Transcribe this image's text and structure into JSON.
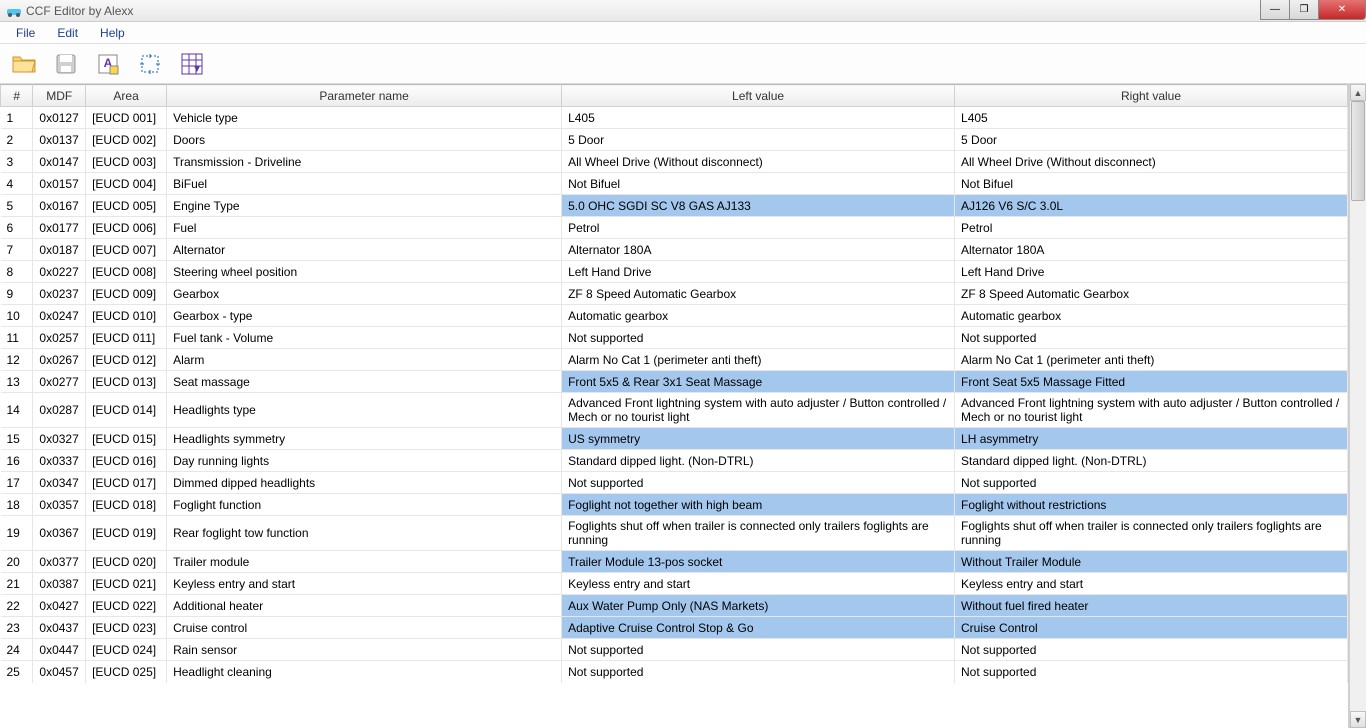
{
  "window": {
    "title": "CCF Editor by Alexx"
  },
  "menu": {
    "file": "File",
    "edit": "Edit",
    "help": "Help"
  },
  "columns": {
    "idx": "#",
    "mdf": "MDF",
    "area": "Area",
    "param": "Parameter name",
    "left": "Left value",
    "right": "Right value"
  },
  "rows": [
    {
      "i": "1",
      "mdf": "0x0127",
      "area": "[EUCD 001]",
      "param": "Vehicle type",
      "left": "L405",
      "right": "L405",
      "hl": false
    },
    {
      "i": "2",
      "mdf": "0x0137",
      "area": "[EUCD 002]",
      "param": "Doors",
      "left": "5 Door",
      "right": "5 Door",
      "hl": false
    },
    {
      "i": "3",
      "mdf": "0x0147",
      "area": "[EUCD 003]",
      "param": "Transmission - Driveline",
      "left": "All Wheel Drive (Without disconnect)",
      "right": "All Wheel Drive (Without disconnect)",
      "hl": false
    },
    {
      "i": "4",
      "mdf": "0x0157",
      "area": "[EUCD 004]",
      "param": "BiFuel",
      "left": "Not Bifuel",
      "right": "Not Bifuel",
      "hl": false
    },
    {
      "i": "5",
      "mdf": "0x0167",
      "area": "[EUCD 005]",
      "param": "Engine Type",
      "left": "5.0 OHC SGDI SC V8 GAS AJ133",
      "right": "AJ126 V6 S/C 3.0L",
      "hl": true
    },
    {
      "i": "6",
      "mdf": "0x0177",
      "area": "[EUCD 006]",
      "param": "Fuel",
      "left": "Petrol",
      "right": "Petrol",
      "hl": false
    },
    {
      "i": "7",
      "mdf": "0x0187",
      "area": "[EUCD 007]",
      "param": "Alternator",
      "left": "Alternator 180A",
      "right": "Alternator 180A",
      "hl": false
    },
    {
      "i": "8",
      "mdf": "0x0227",
      "area": "[EUCD 008]",
      "param": "Steering wheel position",
      "left": "Left Hand Drive",
      "right": "Left Hand Drive",
      "hl": false
    },
    {
      "i": "9",
      "mdf": "0x0237",
      "area": "[EUCD 009]",
      "param": "Gearbox",
      "left": "ZF 8 Speed Automatic Gearbox",
      "right": "ZF 8 Speed Automatic Gearbox",
      "hl": false
    },
    {
      "i": "10",
      "mdf": "0x0247",
      "area": "[EUCD 010]",
      "param": "Gearbox - type",
      "left": "Automatic gearbox",
      "right": "Automatic gearbox",
      "hl": false
    },
    {
      "i": "11",
      "mdf": "0x0257",
      "area": "[EUCD 011]",
      "param": "Fuel tank - Volume",
      "left": "Not supported",
      "right": "Not supported",
      "hl": false
    },
    {
      "i": "12",
      "mdf": "0x0267",
      "area": "[EUCD 012]",
      "param": "Alarm",
      "left": "Alarm No Cat 1 (perimeter anti theft)",
      "right": "Alarm No Cat 1 (perimeter anti theft)",
      "hl": false
    },
    {
      "i": "13",
      "mdf": "0x0277",
      "area": "[EUCD 013]",
      "param": "Seat massage",
      "left": "Front 5x5 & Rear 3x1 Seat Massage",
      "right": "Front Seat 5x5 Massage Fitted",
      "hl": true
    },
    {
      "i": "14",
      "mdf": "0x0287",
      "area": "[EUCD 014]",
      "param": "Headlights type",
      "left": "Advanced Front lightning system with auto adjuster / Button controlled / Mech or no tourist light",
      "right": "Advanced Front lightning system with auto adjuster / Button controlled / Mech or no tourist light",
      "hl": false,
      "tall": true
    },
    {
      "i": "15",
      "mdf": "0x0327",
      "area": "[EUCD 015]",
      "param": "Headlights symmetry",
      "left": "US symmetry",
      "right": "LH asymmetry",
      "hl": true
    },
    {
      "i": "16",
      "mdf": "0x0337",
      "area": "[EUCD 016]",
      "param": "Day running lights",
      "left": "Standard dipped light. (Non-DTRL)",
      "right": "Standard dipped light. (Non-DTRL)",
      "hl": false
    },
    {
      "i": "17",
      "mdf": "0x0347",
      "area": "[EUCD 017]",
      "param": "Dimmed dipped headlights",
      "left": "Not supported",
      "right": "Not supported",
      "hl": false
    },
    {
      "i": "18",
      "mdf": "0x0357",
      "area": "[EUCD 018]",
      "param": "Foglight function",
      "left": "Foglight not together with high beam",
      "right": "Foglight without restrictions",
      "hl": true
    },
    {
      "i": "19",
      "mdf": "0x0367",
      "area": "[EUCD 019]",
      "param": "Rear foglight tow function",
      "left": "Foglights shut off when trailer is connected only trailers foglights are running",
      "right": "Foglights shut off when trailer is connected only trailers foglights are running",
      "hl": false,
      "tall": true
    },
    {
      "i": "20",
      "mdf": "0x0377",
      "area": "[EUCD 020]",
      "param": "Trailer module",
      "left": "Trailer Module 13-pos socket",
      "right": "Without Trailer Module",
      "hl": true
    },
    {
      "i": "21",
      "mdf": "0x0387",
      "area": "[EUCD 021]",
      "param": "Keyless entry and start",
      "left": "Keyless entry and start",
      "right": "Keyless entry and start",
      "hl": false
    },
    {
      "i": "22",
      "mdf": "0x0427",
      "area": "[EUCD 022]",
      "param": "Additional heater",
      "left": "Aux Water Pump Only (NAS Markets)",
      "right": "Without fuel fired heater",
      "hl": true
    },
    {
      "i": "23",
      "mdf": "0x0437",
      "area": "[EUCD 023]",
      "param": "Cruise control",
      "left": "Adaptive Cruise Control Stop & Go",
      "right": "Cruise Control",
      "hl": true
    },
    {
      "i": "24",
      "mdf": "0x0447",
      "area": "[EUCD 024]",
      "param": "Rain sensor",
      "left": "Not supported",
      "right": "Not supported",
      "hl": false
    },
    {
      "i": "25",
      "mdf": "0x0457",
      "area": "[EUCD 025]",
      "param": "Headlight cleaning",
      "left": "Not supported",
      "right": "Not supported",
      "hl": false
    }
  ]
}
